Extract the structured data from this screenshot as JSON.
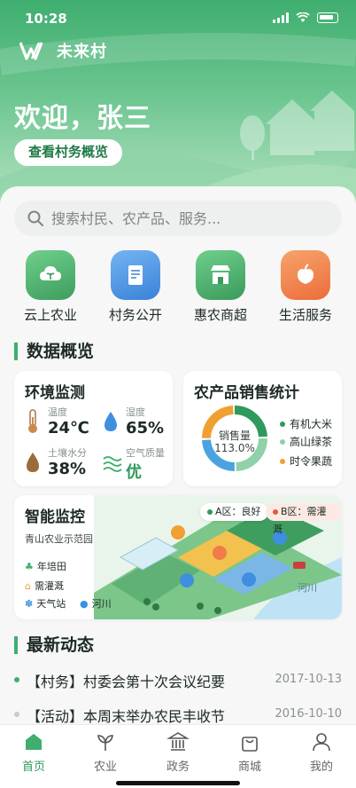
{
  "status_bar": {
    "time": "10:28"
  },
  "brand": {
    "name": "未来村"
  },
  "hero": {
    "welcome": "欢迎，张三",
    "overview_button": "查看村务概览"
  },
  "search": {
    "placeholder": "搜索村民、农产品、服务..."
  },
  "quick_actions": [
    {
      "label": "云上农业",
      "icon": "cloud-plant-icon",
      "color": "#4caf6e"
    },
    {
      "label": "村务公开",
      "icon": "document-icon",
      "color": "#3f8fe0"
    },
    {
      "label": "惠农商超",
      "icon": "store-icon",
      "color": "#45a86a"
    },
    {
      "label": "生活服务",
      "icon": "apple-icon",
      "color": "#f07c4a"
    }
  ],
  "data_section": {
    "title": "数据概览"
  },
  "env": {
    "title": "环境监测",
    "temperature": {
      "label": "温度",
      "value": "24℃"
    },
    "humidity": {
      "label": "湿度",
      "value": "65%"
    },
    "soil": {
      "label": "土壤水分",
      "value": "38%"
    },
    "air": {
      "label": "空气质量",
      "value": "优"
    }
  },
  "sales": {
    "title": "农产品销售统计",
    "center_label": "销售量",
    "center_value": "113.0%",
    "legend": [
      {
        "name": "有机大米",
        "color": "#2f9a5c"
      },
      {
        "name": "高山绿茶",
        "color": "#8fd1a8"
      },
      {
        "name": "时令果蔬",
        "color": "#f0a030"
      }
    ],
    "donut_colors": [
      "#2f9a5c",
      "#8fd1a8",
      "#4aa3df",
      "#f0a030"
    ]
  },
  "monitor": {
    "title": "智能监控",
    "subtitle": "青山农业示范园",
    "zone_a": "A区：良好",
    "zone_b": "B区：需灌溉",
    "river": "河川",
    "legend": [
      "年培田",
      "需灌溉",
      "天气站",
      "河川"
    ]
  },
  "news": {
    "title": "最新动态",
    "items": [
      {
        "text": "【村务】村委会第十次会议纪要",
        "date": "2017-10-13"
      },
      {
        "text": "【活动】本周末举办农民丰收节",
        "date": "2016-10-10"
      }
    ]
  },
  "tabs": [
    {
      "label": "首页",
      "icon": "home-icon"
    },
    {
      "label": "农业",
      "icon": "sprout-icon"
    },
    {
      "label": "政务",
      "icon": "government-icon"
    },
    {
      "label": "商城",
      "icon": "shopping-bag-icon"
    },
    {
      "label": "我的",
      "icon": "user-icon"
    }
  ]
}
